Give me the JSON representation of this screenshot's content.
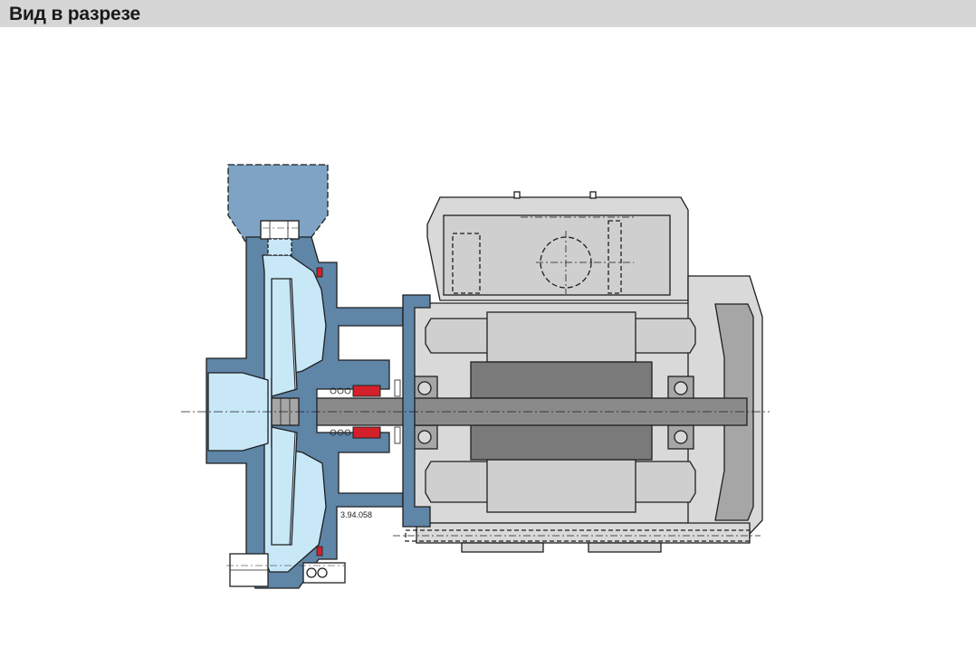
{
  "header": {
    "title": "Вид в разрезе"
  },
  "diagram": {
    "drawing_number": "3.94.058",
    "colors": {
      "pump_casing": "#5f85a7",
      "pump_fluid": "#c8e8f8",
      "pipe_flange": "#7fa3c4",
      "motor_body": "#d9d9d9",
      "motor_dark": "#a6a6a6",
      "rotor": "#7a7a7a",
      "shaft": "#8a8a8a",
      "seal_red": "#d4202a",
      "outline": "#1f1f1f"
    }
  }
}
